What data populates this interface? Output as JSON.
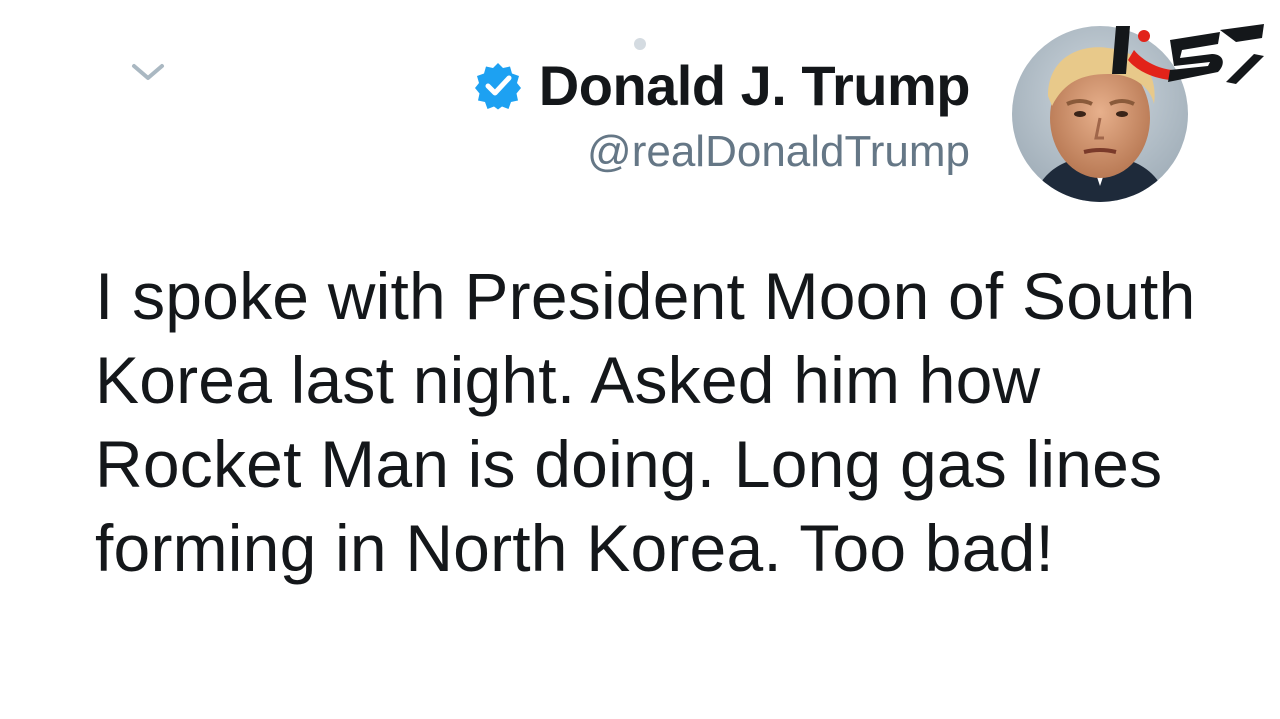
{
  "tweet": {
    "display_name": "Donald J. Trump",
    "handle": "@realDonaldTrump",
    "text": "I spoke with President Moon of South Korea last night. Asked him how Rocket Man is doing. Long gas lines forming in North Korea. Too bad!"
  },
  "icons": {
    "verified": "verified-badge-icon",
    "chevron": "chevron-down-icon",
    "avatar": "profile-avatar",
    "watermark": "news-site-logo"
  },
  "colors": {
    "verified_blue": "#1da1f2",
    "text": "#14171a",
    "handle_gray": "#657786",
    "logo_red": "#e2231a"
  }
}
